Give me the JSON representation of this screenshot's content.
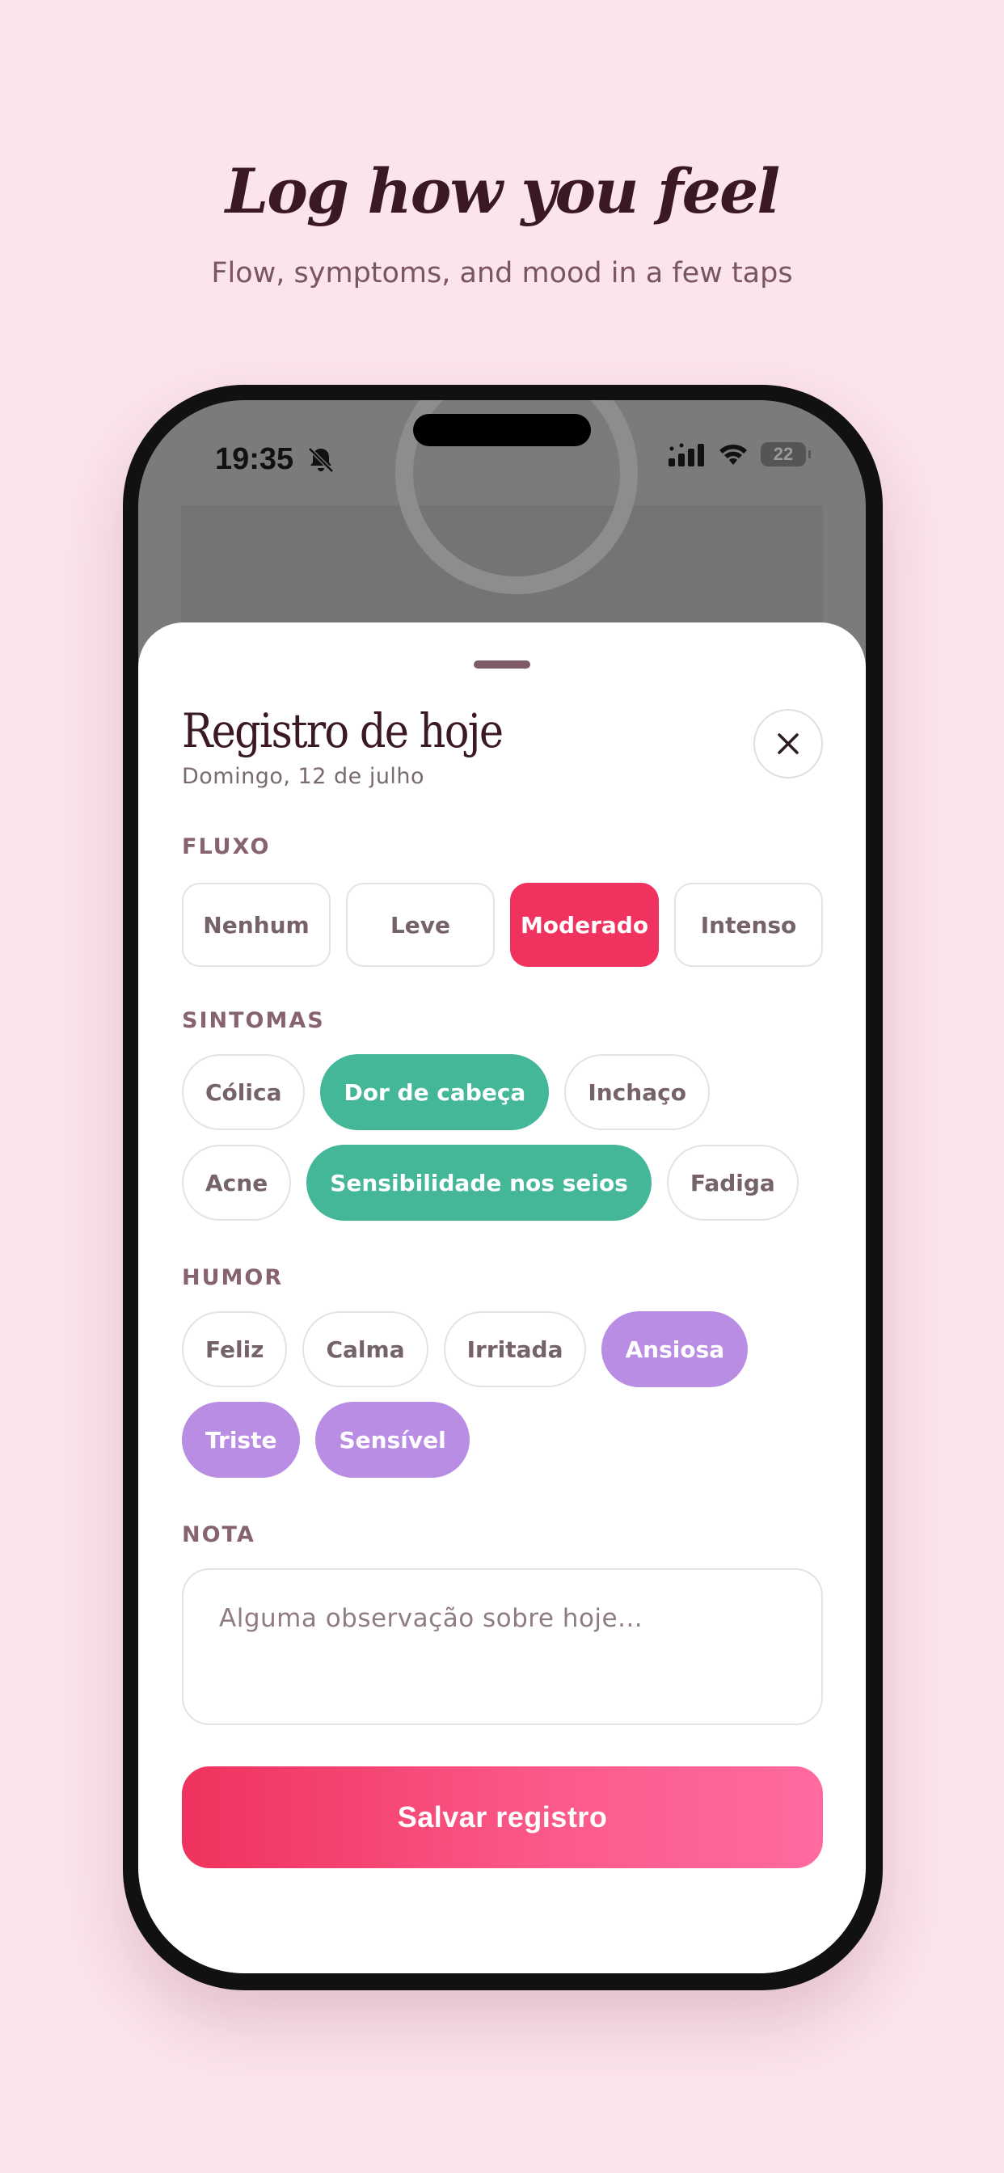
{
  "promo": {
    "headline": "Log how you feel",
    "subhead": "Flow, symptoms, and mood in a few taps"
  },
  "status_bar": {
    "time": "19:35",
    "battery": "22",
    "icons": [
      "bell-slash-icon",
      "cellular-signal-icon",
      "wifi-icon",
      "battery-icon"
    ]
  },
  "sheet": {
    "title": "Registro de hoje",
    "date": "Domingo, 12 de julho",
    "close_icon": "close-icon"
  },
  "flow": {
    "label": "FLUXO",
    "options": [
      {
        "label": "Nenhum",
        "selected": false
      },
      {
        "label": "Leve",
        "selected": false
      },
      {
        "label": "Moderado",
        "selected": true
      },
      {
        "label": "Intenso",
        "selected": false
      }
    ]
  },
  "symptoms": {
    "label": "SINTOMAS",
    "options": [
      {
        "label": "Cólica",
        "selected": false
      },
      {
        "label": "Dor de cabeça",
        "selected": true
      },
      {
        "label": "Inchaço",
        "selected": false
      },
      {
        "label": "Acne",
        "selected": false
      },
      {
        "label": "Sensibilidade nos seios",
        "selected": true
      },
      {
        "label": "Fadiga",
        "selected": false
      }
    ]
  },
  "mood": {
    "label": "HUMOR",
    "options": [
      {
        "label": "Feliz",
        "selected": false
      },
      {
        "label": "Calma",
        "selected": false
      },
      {
        "label": "Irritada",
        "selected": false
      },
      {
        "label": "Ansiosa",
        "selected": true
      },
      {
        "label": "Triste",
        "selected": true
      },
      {
        "label": "Sensível",
        "selected": true
      }
    ]
  },
  "note": {
    "label": "NOTA",
    "value": "",
    "placeholder": "Alguma observação sobre hoje..."
  },
  "save_label": "Salvar registro",
  "colors": {
    "background": "#fbe4ea",
    "flow_selected": "#f0325e",
    "symptom_selected": "#44b799",
    "mood_selected": "#b98de3",
    "title_text": "#3a1824"
  }
}
